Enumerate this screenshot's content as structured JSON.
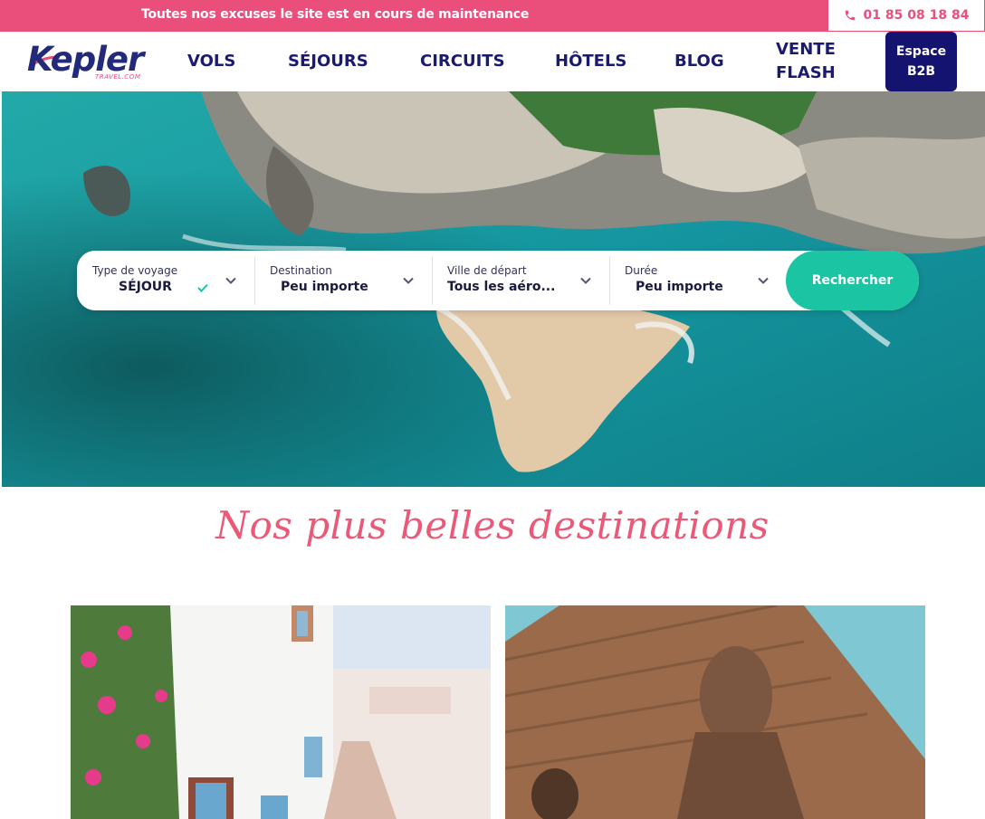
{
  "topbar": {
    "message": "Toutes nos excuses le site est en cours de maintenance",
    "phone": "01 85 08 18 84"
  },
  "logo": {
    "name": "Kepler",
    "sub": "TRAVEL.COM"
  },
  "nav": {
    "items": [
      "VOLS",
      "SÉJOURS",
      "CIRCUITS",
      "HÔTELS",
      "BLOG"
    ],
    "vente_flash": [
      "VENTE",
      "FLASH"
    ],
    "b2b": [
      "Espace",
      "B2B"
    ]
  },
  "search": {
    "type": {
      "label": "Type de voyage",
      "value": "SÉJOUR"
    },
    "destination": {
      "label": "Destination",
      "value": "Peu importe"
    },
    "depart": {
      "label": "Ville de départ",
      "value": "Tous les aéro..."
    },
    "duree": {
      "label": "Durée",
      "value": "Peu importe"
    },
    "button": "Rechercher"
  },
  "section": {
    "title": "Nos plus belles destinations"
  },
  "icons": {
    "phone": "phone-icon",
    "check": "check-icon",
    "chevron": "chevron-down-icon"
  },
  "colors": {
    "brand_pink": "#ea4f7c",
    "navy": "#141470",
    "teal": "#1bc4a3"
  }
}
